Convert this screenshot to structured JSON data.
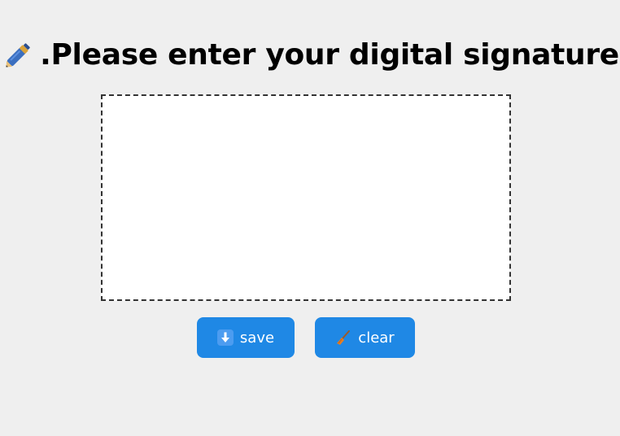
{
  "header": {
    "title": ".Please enter your digital signature",
    "icon": "pen-icon"
  },
  "signature_pad": {
    "border_style": "dashed",
    "background": "#ffffff",
    "border_color": "#333333"
  },
  "actions": {
    "save_label": "save",
    "save_icon": "download-arrow-icon",
    "clear_label": "clear",
    "clear_icon": "broom-icon",
    "button_color": "#1f88e5"
  }
}
